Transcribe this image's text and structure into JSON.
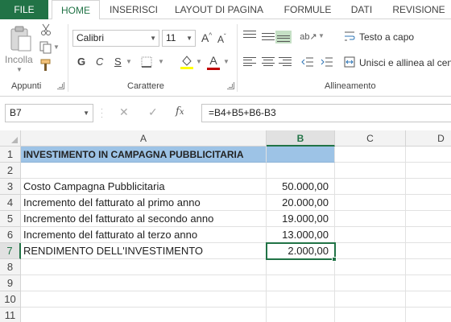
{
  "tabs": {
    "file": "FILE",
    "home": "HOME",
    "insert": "INSERISCI",
    "layout": "LAYOUT DI PAGINA",
    "formulas": "FORMULE",
    "data": "DATI",
    "review": "REVISIONE"
  },
  "ribbon": {
    "clipboard": {
      "paste_label": "Incolla",
      "group_label": "Appunti"
    },
    "font": {
      "font_name": "Calibri",
      "font_size": "11",
      "grow_label": "A",
      "shrink_label": "A",
      "bold": "G",
      "italic": "C",
      "underline": "S",
      "font_color_label": "A",
      "group_label": "Carattere",
      "font_color": "#c00000",
      "fill_color": "#ffff00"
    },
    "alignment": {
      "wrap_text": "Testo a capo",
      "merge_center": "Unisci e allinea al cent",
      "group_label": "Allineamento"
    }
  },
  "formula_bar": {
    "name_box": "B7",
    "formula": "=B4+B5+B6-B3"
  },
  "grid": {
    "columns": [
      "A",
      "B",
      "C",
      "D"
    ],
    "selected_column": "B",
    "rows": [
      "1",
      "2",
      "3",
      "4",
      "5",
      "6",
      "7",
      "8",
      "9",
      "10",
      "11"
    ],
    "selected_row": "7",
    "cells": {
      "A1": "INVESTIMENTO IN CAMPAGNA PUBBLICITARIA",
      "A3": "Costo Campagna Pubblicitaria",
      "B3": "50.000,00",
      "A4": "Incremento del fatturato al primo anno",
      "B4": "20.000,00",
      "A5": "Incremento del fatturato al secondo anno",
      "B5": "19.000,00",
      "A6": "Incremento del fatturato al terzo anno",
      "B6": "13.000,00",
      "A7": "RENDIMENTO DELL'INVESTIMENTO",
      "B7": "2.000,00"
    },
    "header_fill": "#9dc3e6",
    "accent": "#217346"
  }
}
